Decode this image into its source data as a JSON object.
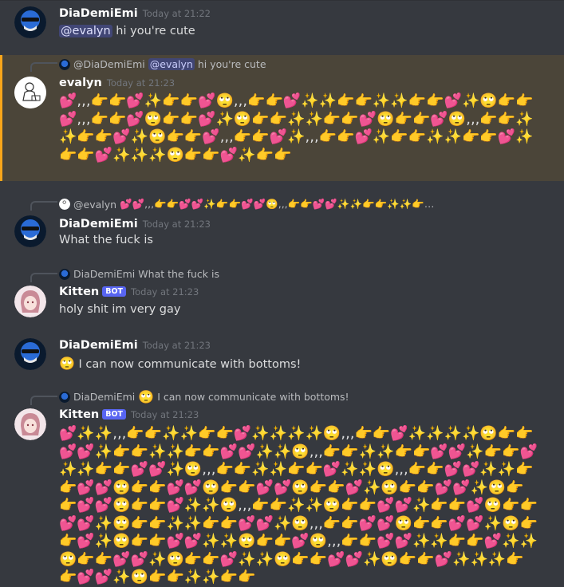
{
  "messages": [
    {
      "author": "DiaDemiEmi",
      "time": "Today at 21:22",
      "mention": "@evalyn",
      "text": " hi you're cute"
    },
    {
      "reply": {
        "author": "@DiaDemiEmi",
        "mention": "@evalyn",
        "text": "hi you're cute"
      },
      "author": "evalyn",
      "time": "Today at 21:23",
      "emoji_text": "💕,,,👉👉💕✨👉👉💕🙄,,,👉👉💕✨✨👉👉✨✨👉👉💕✨🙄👉👉💕,,,👉👉💕🙄👉👉💕✨🙄👉👉✨✨👉👉💕🙄👉👉💕🙄,,,👉👉✨✨👉👉💕✨🙄👉👉💕,,,👉👉💕✨,,,👉👉💕✨👉👉✨✨👉👉💕✨👉👉💕✨✨✨🙄👉👉💕✨👉👉"
    },
    {
      "reply": {
        "author": "@evalyn",
        "text": "💕💕,,,👉👉💕💕✨👉👉💕💕🙄,,,👉👉💕💕✨✨👉👉✨✨👉…"
      },
      "author": "DiaDemiEmi",
      "time": "Today at 21:23",
      "text": "What the fuck is"
    },
    {
      "reply": {
        "author": "DiaDemiEmi",
        "text": "What the fuck is"
      },
      "author": "Kitten",
      "badge": "BOT",
      "time": "Today at 21:23",
      "text": "holy shit im very gay"
    },
    {
      "author": "DiaDemiEmi",
      "time": "Today at 21:23",
      "emoji": "🙄",
      "text": " I can now communicate with bottoms!"
    },
    {
      "reply": {
        "author": "DiaDemiEmi",
        "emoji": "🙄",
        "text": "I can now communicate with bottoms!"
      },
      "author": "Kitten",
      "badge": "BOT",
      "time": "Today at 21:23",
      "emoji_text": "💕✨✨,,,👉👉✨✨👉👉💕✨✨✨✨🙄,,,👉👉💕✨✨✨✨🙄👉👉💕💕✨👉👉✨✨👉👉💕💕✨✨🙄,,,👉👉✨✨👉👉💕💕✨👉👉💕✨✨👉👉💕💕✨🙄,,,👉👉✨✨👉👉💕✨✨🙄,,,👉👉💕💕✨✨👉👉💕💕🙄👉👉💕💕🙄👉👉💕💕🙄👉👉💕✨🙄👉👉💕💕✨🙄👉👉💕💕🙄👉👉💕✨✨🙄,,,👉👉✨✨🙄👉👉💕💕✨👉👉💕🙄👉👉💕💕✨🙄👉👉✨✨👉👉💕💕✨🙄,,,👉👉💕💕🙄👉👉💕💕✨🙄👉👉💕✨🙄👉👉💕💕✨✨🙄👉👉💕🙄,,,👉👉💕💕✨✨👉👉💕✨✨🙄👉👉💕💕✨🙄👉👉💕✨✨🙄👉👉💕💕✨🙄👉👉💕✨✨✨👉👉💕💕✨🙄👉👉✨✨👉👉"
    }
  ]
}
